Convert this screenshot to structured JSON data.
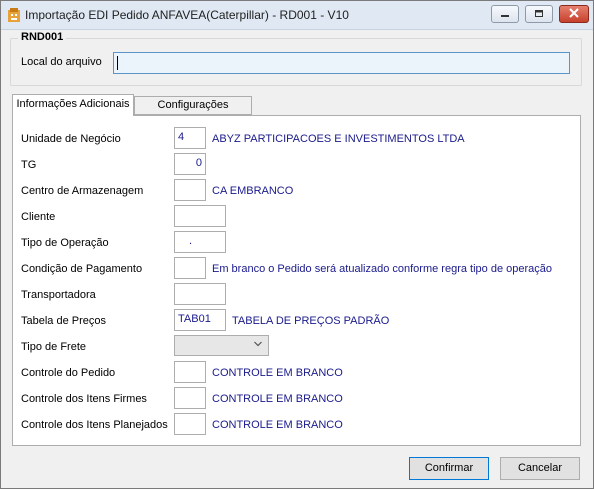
{
  "window": {
    "title": "Importação EDI Pedido ANFAVEA(Caterpillar) - RD001 - V10"
  },
  "group": {
    "title": "RND001",
    "local_label": "Local do arquivo",
    "local_value": ""
  },
  "tabs": [
    {
      "label": "Informações Adicionais"
    },
    {
      "label": "Configurações"
    }
  ],
  "fields": {
    "unidade": {
      "label": "Unidade de Negócio",
      "value": "4",
      "desc": "ABYZ PARTICIPACOES E INVESTIMENTOS LTDA"
    },
    "tg": {
      "label": "TG",
      "value": "0"
    },
    "centro": {
      "label": "Centro de Armazenagem",
      "value": "",
      "desc": "CA EMBRANCO"
    },
    "cliente": {
      "label": "Cliente",
      "value": ""
    },
    "tipo_operacao": {
      "label": "Tipo de Operação",
      "value": "."
    },
    "condicao": {
      "label": "Condição de Pagamento",
      "value": "",
      "desc": "Em branco o Pedido será atualizado conforme regra tipo de operação"
    },
    "transportadora": {
      "label": "Transportadora",
      "value": ""
    },
    "tabela": {
      "label": "Tabela de Preços",
      "value": "TAB01",
      "desc": "TABELA DE PREÇOS PADRÃO"
    },
    "tipo_frete": {
      "label": "Tipo de Frete",
      "value": ""
    },
    "controle_pedido": {
      "label": "Controle do Pedido",
      "value": "",
      "desc": "CONTROLE EM BRANCO"
    },
    "controle_firmes": {
      "label": "Controle dos Itens Firmes",
      "value": "",
      "desc": "CONTROLE EM BRANCO"
    },
    "controle_planejados": {
      "label": "Controle dos Itens Planejados",
      "value": "",
      "desc": "CONTROLE EM BRANCO"
    }
  },
  "buttons": {
    "confirm": "Confirmar",
    "cancel": "Cancelar"
  },
  "colors": {
    "titlebar": "#dfe8f3",
    "value_text": "#1a1a8c",
    "focus_border": "#5b94c8",
    "close_button": "#c6412c"
  },
  "icons": [
    "app-icon",
    "minimize-icon",
    "maximize-icon",
    "close-icon",
    "chevron-down-icon"
  ]
}
